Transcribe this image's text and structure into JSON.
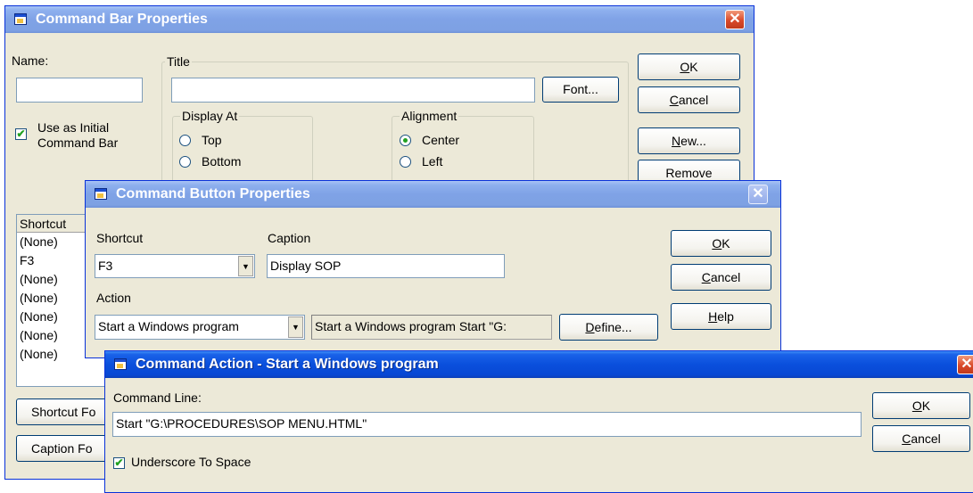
{
  "bar_dialog": {
    "title": "Command Bar Properties",
    "name_label": "Name:",
    "name_value": "",
    "initial_check_line1": "Use as Initial",
    "initial_check_line2": "Command Bar",
    "title_group": "Title",
    "title_value": "",
    "font_button": "Font...",
    "display_at_group": "Display At",
    "display_options": [
      "Top",
      "Bottom"
    ],
    "alignment_group": "Alignment",
    "alignment_options": [
      "Center",
      "Left"
    ],
    "list_header": "Shortcut",
    "list_rows": [
      "(None)",
      "F3",
      "(None)",
      "(None)",
      "(None)",
      "(None)",
      "(None)"
    ],
    "shortcut_font_button": "Shortcut Fo",
    "caption_font_button": "Caption Fo",
    "ok_u": "O",
    "ok_rest": "K",
    "cancel_u": "C",
    "cancel_rest": "ancel",
    "new_u": "N",
    "new_rest": "ew...",
    "remove_button": "Remove"
  },
  "button_dialog": {
    "title": "Command Button Properties",
    "shortcut_label": "Shortcut",
    "shortcut_value": "F3",
    "caption_label": "Caption",
    "caption_value": "Display SOP",
    "action_label": "Action",
    "action_value": "Start a Windows program",
    "action_desc": "Start a Windows program Start \"G:",
    "define_u": "D",
    "define_rest": "efine...",
    "ok_u": "O",
    "ok_rest": "K",
    "cancel_u": "C",
    "cancel_rest": "ancel",
    "help_u": "H",
    "help_rest": "elp"
  },
  "action_dialog": {
    "title": "Command Action - Start a Windows program",
    "command_line_label": "Command Line:",
    "command_line_value": "Start \"G:\\PROCEDURES\\SOP MENU.HTML\"",
    "underscore_label": "Underscore To Space",
    "ok_u": "O",
    "ok_rest": "K",
    "cancel_u": "C",
    "cancel_rest": "ancel"
  },
  "icons": {
    "close": "close-icon",
    "app": "app-icon",
    "dropdown": "chevron-down-icon"
  },
  "colors": {
    "title_active": "#0a4fdc",
    "title_inactive": "#7fa2e6",
    "dialog_bg": "#ece9d8",
    "close_red": "#d9492a"
  }
}
